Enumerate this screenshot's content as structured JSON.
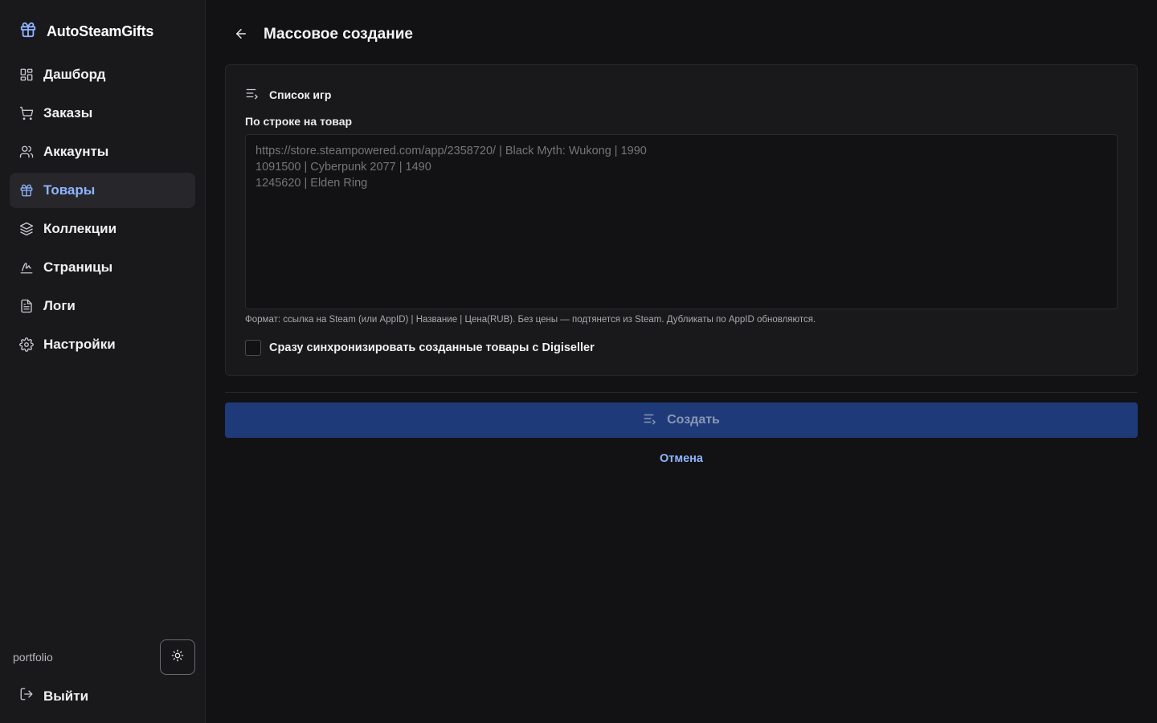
{
  "brand": {
    "name": "AutoSteamGifts",
    "icon": "gift-icon"
  },
  "sidebar": {
    "items": [
      {
        "label": "Дашборд",
        "icon": "dashboard-grid-icon",
        "active": false
      },
      {
        "label": "Заказы",
        "icon": "cart-icon",
        "active": false
      },
      {
        "label": "Аккаунты",
        "icon": "users-icon",
        "active": false
      },
      {
        "label": "Товары",
        "icon": "gift-icon",
        "active": true
      },
      {
        "label": "Коллекции",
        "icon": "layers-icon",
        "active": false
      },
      {
        "label": "Страницы",
        "icon": "signature-icon",
        "active": false
      },
      {
        "label": "Логи",
        "icon": "document-icon",
        "active": false
      },
      {
        "label": "Настройки",
        "icon": "gear-icon",
        "active": false
      }
    ],
    "user": "portfolio",
    "logout_label": "Выйти"
  },
  "page": {
    "title": "Массовое создание"
  },
  "card": {
    "section_title": "Список игр",
    "field_label": "По строке на товар",
    "textarea_placeholder": "https://store.steampowered.com/app/2358720/ | Black Myth: Wukong | 1990\n1091500 | Cyberpunk 2077 | 1490\n1245620 | Elden Ring",
    "hint": "Формат: ссылка на Steam (или AppID) | Название | Цена(RUB). Без цены — подтянется из Steam. Дубликаты по AppID обновляются.",
    "checkbox_label": "Сразу синхронизировать созданные товары с Digiseller",
    "checkbox_checked": false
  },
  "actions": {
    "create_label": "Создать",
    "cancel_label": "Отмена"
  },
  "colors": {
    "accent": "#8fb4ff",
    "primary_button": "#1f3a78",
    "background": "#121214",
    "sidebar": "#19191c"
  }
}
